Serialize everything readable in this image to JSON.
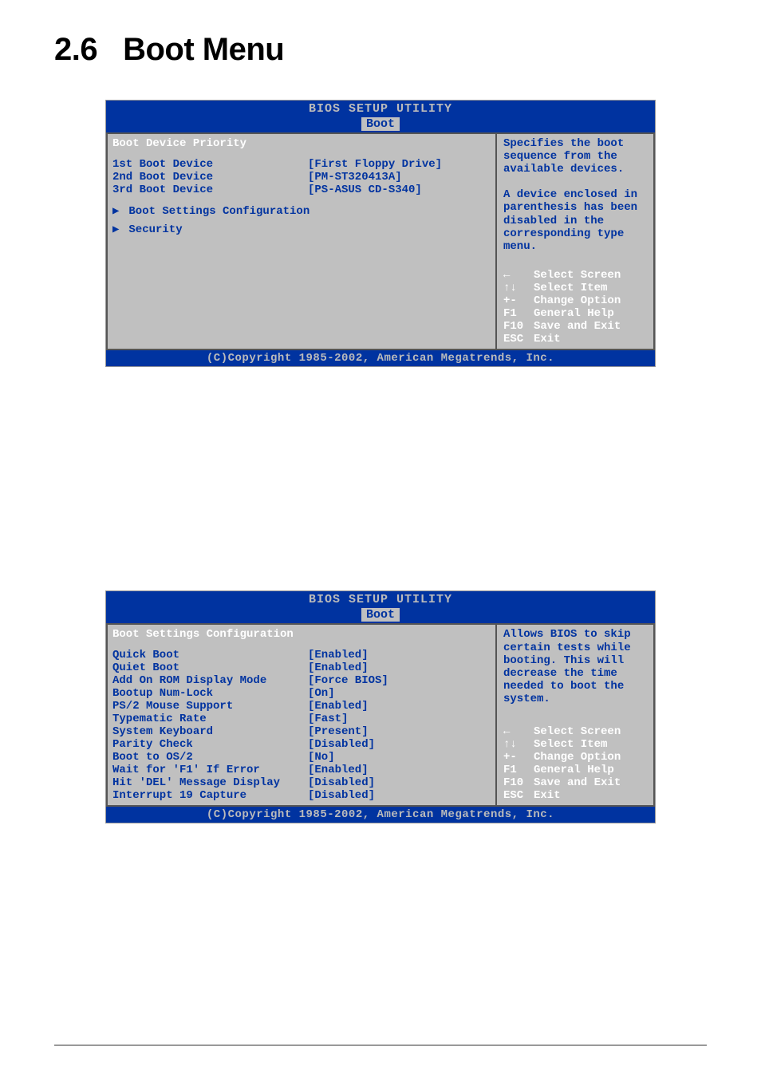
{
  "heading": {
    "number": "2.6",
    "title": "Boot Menu"
  },
  "bios1": {
    "header_title": "BIOS SETUP UTILITY",
    "tab": "Boot",
    "section_title": "Boot Device Priority",
    "items": [
      {
        "label": "1st Boot Device",
        "value": "[First Floppy Drive]"
      },
      {
        "label": "2nd Boot Device",
        "value": "[PM-ST320413A]"
      },
      {
        "label": "3rd Boot Device",
        "value": "[PS-ASUS CD-S340]"
      }
    ],
    "submenus": [
      "Boot Settings Configuration",
      "Security"
    ],
    "help_text": "Specifies the boot sequence from the available devices.\n\nA device enclosed in parenthesis has been disabled in the corresponding type menu.",
    "keys": [
      {
        "icon": "←",
        "label": "Select Screen"
      },
      {
        "icon": "↑↓",
        "label": "Select Item"
      },
      {
        "icon": "+-",
        "label": "Change Option"
      },
      {
        "icon": "F1",
        "label": "General Help"
      },
      {
        "icon": "F10",
        "label": "Save and Exit"
      },
      {
        "icon": "ESC",
        "label": "Exit"
      }
    ],
    "footer": "(C)Copyright 1985-2002, American Megatrends, Inc."
  },
  "bios2": {
    "header_title": "BIOS SETUP UTILITY",
    "tab": "Boot",
    "section_title": "Boot Settings Configuration",
    "items": [
      {
        "label": "Quick Boot",
        "value": "[Enabled]"
      },
      {
        "label": "Quiet Boot",
        "value": "[Enabled]"
      },
      {
        "label": "Add On ROM Display Mode",
        "value": "[Force BIOS]"
      },
      {
        "label": "Bootup Num-Lock",
        "value": "[On]"
      },
      {
        "label": "PS/2 Mouse Support",
        "value": "[Enabled]"
      },
      {
        "label": "Typematic Rate",
        "value": "[Fast]"
      },
      {
        "label": "System Keyboard",
        "value": "[Present]"
      },
      {
        "label": "Parity Check",
        "value": "[Disabled]"
      },
      {
        "label": "Boot to OS/2",
        "value": "[No]"
      },
      {
        "label": "Wait for 'F1' If Error",
        "value": "[Enabled]"
      },
      {
        "label": "Hit 'DEL' Message Display",
        "value": "[Disabled]"
      },
      {
        "label": "Interrupt 19 Capture",
        "value": "[Disabled]"
      }
    ],
    "help_text": "Allows BIOS to skip certain tests while booting. This will decrease the time needed to boot the system.",
    "keys": [
      {
        "icon": "←",
        "label": "Select Screen"
      },
      {
        "icon": "↑↓",
        "label": "Select Item"
      },
      {
        "icon": "+-",
        "label": "Change Option"
      },
      {
        "icon": "F1",
        "label": "General Help"
      },
      {
        "icon": "F10",
        "label": "Save and Exit"
      },
      {
        "icon": "ESC",
        "label": "Exit"
      }
    ],
    "footer": "(C)Copyright 1985-2002, American Megatrends, Inc."
  }
}
